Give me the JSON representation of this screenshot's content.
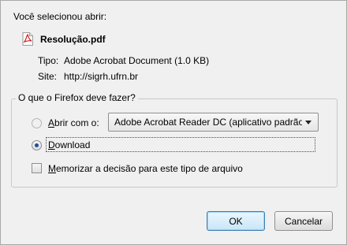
{
  "dialog": {
    "intro_text": "Você selecionou abrir:",
    "file_name": "Resolução.pdf",
    "type_label": "Tipo:",
    "type_value": "Adobe Acrobat Document (1.0 KB)",
    "site_label": "Site:",
    "site_value": "http://sigrh.ufrn.br"
  },
  "options": {
    "legend": "O que o Firefox deve fazer?",
    "open_with_prefix": "A",
    "open_with_rest": "brir com o:",
    "open_with_selected": false,
    "app_select_value": "Adobe Acrobat Reader DC  (aplicativo padrão)",
    "download_prefix": "D",
    "download_rest": "ownload",
    "download_selected": true,
    "remember_prefix": "M",
    "remember_rest": "emorizar a decisão para este tipo de arquivo",
    "remember_checked": false
  },
  "buttons": {
    "ok_label": "OK",
    "cancel_label": "Cancelar"
  },
  "icons": {
    "file_icon": "pdf-file-icon",
    "dropdown_icon": "chevron-down-icon"
  }
}
